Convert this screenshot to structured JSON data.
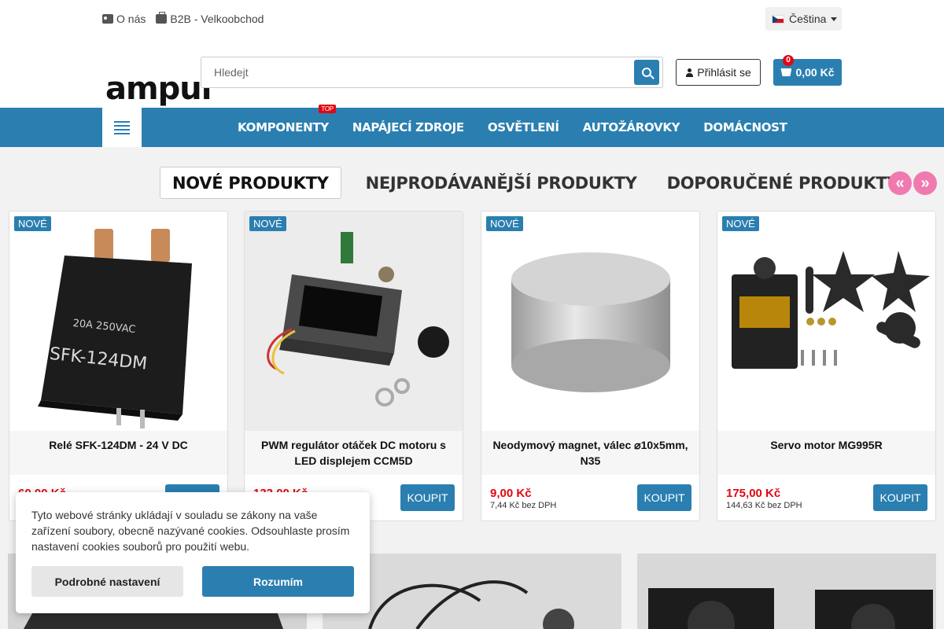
{
  "topbar": {
    "about_label": "O nás",
    "b2b_label": "B2B - Velkoobchod",
    "language": "Čeština"
  },
  "logo": {
    "text": "ampul"
  },
  "search": {
    "placeholder": "Hledejt"
  },
  "account": {
    "login_label": "Přihlásit se"
  },
  "cart": {
    "count": "0",
    "total": "0,00 Kč"
  },
  "nav": {
    "items": [
      {
        "label": "KOMPONENTY",
        "badge": "TOP"
      },
      {
        "label": "NAPÁJECÍ ZDROJE"
      },
      {
        "label": "OSVĚTLENÍ"
      },
      {
        "label": "AUTOŽÁROVKY"
      },
      {
        "label": "DOMÁCNOST"
      }
    ]
  },
  "tabs": [
    {
      "label": "NOVÉ PRODUKTY",
      "active": true
    },
    {
      "label": "NEJPRODÁVANĚJŠÍ PRODUKTY"
    },
    {
      "label": "DOPORUČENÉ PRODUKTY"
    }
  ],
  "carousel": {
    "prev_icon": "double-chevron-left-icon",
    "next_icon": "double-chevron-right-icon"
  },
  "products": [
    {
      "badge": "NOVÉ",
      "name": "Relé SFK-124DM - 24 V DC",
      "price": "60,00 Kč",
      "price_net": "",
      "buy_label": "KOUPIT"
    },
    {
      "badge": "NOVÉ",
      "name": "PWM regulátor otáček DC motoru s LED displejem CCM5D",
      "price": "133,00 Kč",
      "price_net": "",
      "buy_label": "KOUPIT"
    },
    {
      "badge": "NOVÉ",
      "name": "Neodymový magnet, válec ⌀10x5mm, N35",
      "price": "9,00 Kč",
      "price_net": "7,44 Kč bez DPH",
      "buy_label": "KOUPIT"
    },
    {
      "badge": "NOVÉ",
      "name": "Servo motor MG995R",
      "price": "175,00 Kč",
      "price_net": "144,63 Kč bez DPH",
      "buy_label": "KOUPIT"
    }
  ],
  "cookie": {
    "text": "Tyto webové stránky ukládají v souladu se zákony na vaše zařízení soubory, obecně nazývané cookies. Odsouhlaste prosím nastavení cookies souborů pro použití webu.",
    "settings_label": "Podrobné nastavení",
    "accept_label": "Rozumím"
  },
  "colors": {
    "primary": "#2a7fb0",
    "price": "#e30613",
    "arrow": "#f07ab0"
  }
}
